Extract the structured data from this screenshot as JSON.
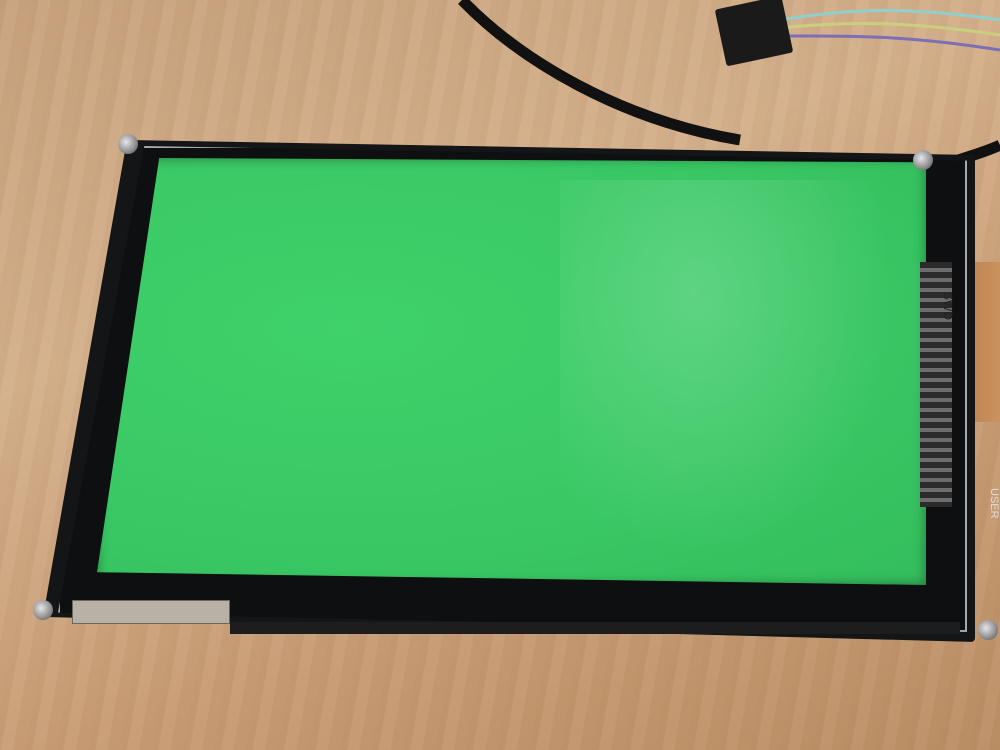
{
  "scene": {
    "description_labels": [],
    "colors": {
      "screen": "#3ac865",
      "desk": "#c9a47f",
      "bezel": "#141517",
      "frame": "#a9aaa8"
    },
    "board_text": [
      {
        "text": "SWD"
      },
      {
        "text": "USER"
      }
    ]
  }
}
